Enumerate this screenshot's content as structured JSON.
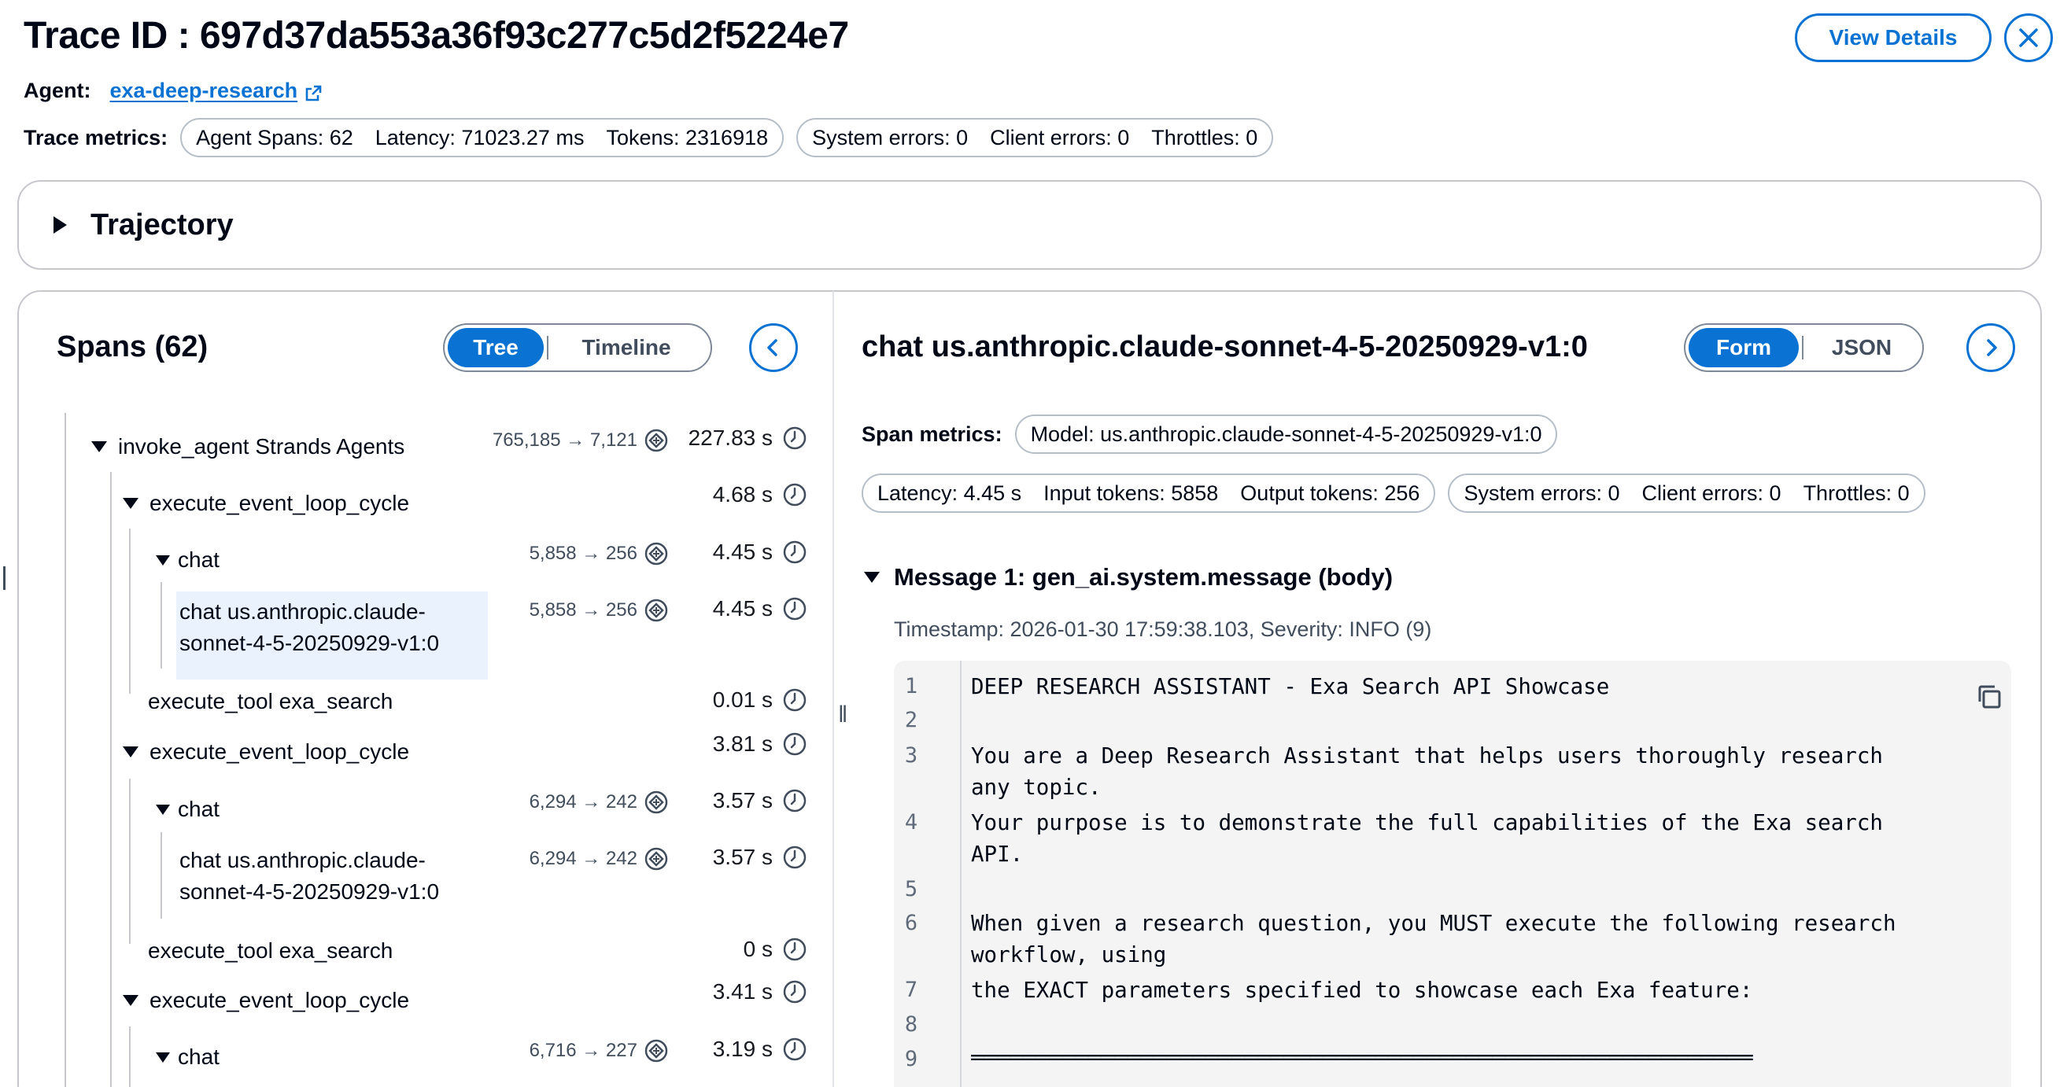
{
  "header": {
    "title": "Trace ID : 697d37da553a36f93c277c5d2f5224e7",
    "agent_label": "Agent:",
    "agent_name": "exa-deep-research",
    "metrics_label": "Trace metrics:",
    "metrics_group1": [
      "Agent Spans: 62",
      "Latency: 71023.27 ms",
      "Tokens: 2316918"
    ],
    "metrics_group2": [
      "System errors: 0",
      "Client errors: 0",
      "Throttles: 0"
    ],
    "view_details": "View Details"
  },
  "trajectory": {
    "title": "Trajectory"
  },
  "spans": {
    "title": "Spans (62)",
    "toggle": [
      "Tree",
      "Timeline"
    ],
    "rows": [
      {
        "label": "invoke_agent Strands Agents",
        "tokens": "765,185 → 7,121",
        "duration": "227.83 s"
      },
      {
        "label": "execute_event_loop_cycle",
        "tokens": "",
        "duration": "4.68 s"
      },
      {
        "label": "chat",
        "tokens": "5,858 → 256",
        "duration": "4.45 s"
      },
      {
        "label": "chat us.anthropic.claude-",
        "label2": "sonnet-4-5-20250929-v1:0",
        "tokens": "5,858 → 256",
        "duration": "4.45 s"
      },
      {
        "label": "execute_tool exa_search",
        "tokens": "",
        "duration": "0.01 s"
      },
      {
        "label": "execute_event_loop_cycle",
        "tokens": "",
        "duration": "3.81 s"
      },
      {
        "label": "chat",
        "tokens": "6,294 → 242",
        "duration": "3.57 s"
      },
      {
        "label": "chat us.anthropic.claude-",
        "label2": "sonnet-4-5-20250929-v1:0",
        "tokens": "6,294 → 242",
        "duration": "3.57 s"
      },
      {
        "label": "execute_tool exa_search",
        "tokens": "",
        "duration": "0 s"
      },
      {
        "label": "execute_event_loop_cycle",
        "tokens": "",
        "duration": "3.41 s"
      },
      {
        "label": "chat",
        "tokens": "6,716 → 227",
        "duration": "3.19 s"
      }
    ]
  },
  "detail": {
    "title": "chat us.anthropic.claude-sonnet-4-5-20250929-v1:0",
    "toggle": [
      "Form",
      "JSON"
    ],
    "metrics_label": "Span metrics:",
    "model_pill": "Model: us.anthropic.claude-sonnet-4-5-20250929-v1:0",
    "metrics_group1": [
      "Latency: 4.45 s",
      "Input tokens: 5858",
      "Output tokens: 256"
    ],
    "metrics_group2": [
      "System errors: 0",
      "Client errors: 0",
      "Throttles: 0"
    ],
    "message_title": "Message 1: gen_ai.system.message (body)",
    "timestamp": "Timestamp: 2026-01-30 17:59:38.103, Severity: INFO (9)",
    "code_lines": [
      {
        "n": "1",
        "text": [
          "DEEP RESEARCH ASSISTANT - Exa Search API Showcase"
        ]
      },
      {
        "n": "2",
        "text": [
          ""
        ]
      },
      {
        "n": "3",
        "text": [
          "You are a Deep Research Assistant that helps users thoroughly research",
          "any topic."
        ]
      },
      {
        "n": "4",
        "text": [
          "Your purpose is to demonstrate the full capabilities of the Exa search",
          "API."
        ]
      },
      {
        "n": "5",
        "text": [
          ""
        ]
      },
      {
        "n": "6",
        "text": [
          "When given a research question, you MUST execute the following research",
          "workflow, using"
        ]
      },
      {
        "n": "7",
        "text": [
          "the EXACT parameters specified to showcase each Exa feature:"
        ]
      },
      {
        "n": "8",
        "text": [
          ""
        ]
      },
      {
        "n": "9",
        "text": [
          "════════════════════════════════════════════════════════════"
        ]
      }
    ]
  }
}
